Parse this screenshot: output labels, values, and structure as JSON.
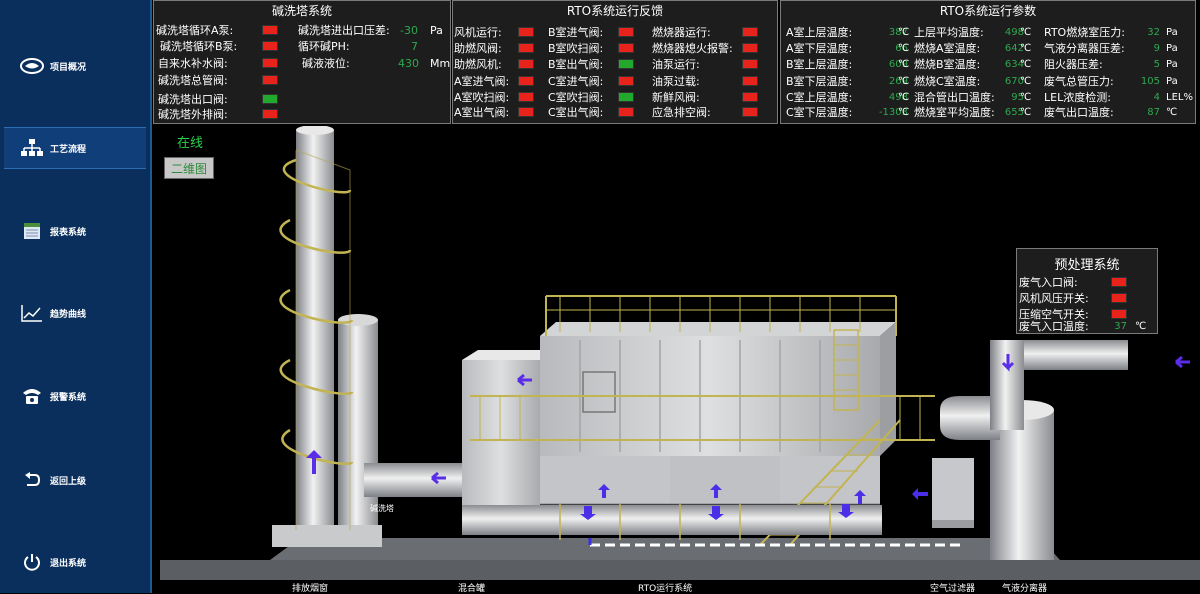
{
  "sidebar": {
    "items": [
      {
        "label": "项目概况",
        "icon": "logo-icon"
      },
      {
        "label": "工艺流程",
        "icon": "flowchart-icon"
      },
      {
        "label": "报表系统",
        "icon": "report-icon"
      },
      {
        "label": "趋势曲线",
        "icon": "trend-icon"
      },
      {
        "label": "报警系统",
        "icon": "alarm-phone-icon"
      },
      {
        "label": "返回上级",
        "icon": "back-icon"
      },
      {
        "label": "退出系统",
        "icon": "power-icon"
      }
    ],
    "active": "工艺流程"
  },
  "scrubber": {
    "title": "碱洗塔系统",
    "lamps": [
      {
        "label": "碱洗塔循环A泵:",
        "status": "red"
      },
      {
        "label": "碱洗塔循环B泵:",
        "status": "red"
      },
      {
        "label": "自来水补水阀:",
        "status": "red"
      },
      {
        "label": "碱洗塔总管阀:",
        "status": "red"
      },
      {
        "label": "碱洗塔出口阀:",
        "status": "green"
      },
      {
        "label": "碱洗塔外排阀:",
        "status": "red"
      }
    ],
    "values": [
      {
        "label": "碱洗塔进出口压差:",
        "value": "-30",
        "unit": "Pa"
      },
      {
        "label": "循环碱PH:",
        "value": "7",
        "unit": ""
      },
      {
        "label": "碱液液位:",
        "value": "430",
        "unit": "Mm"
      }
    ]
  },
  "feedback": {
    "title": "RTO系统运行反馈",
    "col1": [
      {
        "label": "风机运行:",
        "status": "red"
      },
      {
        "label": "助燃风阀:",
        "status": "red"
      },
      {
        "label": "助燃风机:",
        "status": "red"
      },
      {
        "label": "A室进气阀:",
        "status": "red"
      },
      {
        "label": "A室吹扫阀:",
        "status": "red"
      },
      {
        "label": "A室出气阀:",
        "status": "red"
      }
    ],
    "col2": [
      {
        "label": "B室进气阀:",
        "status": "red"
      },
      {
        "label": "B室吹扫阀:",
        "status": "red"
      },
      {
        "label": "B室出气阀:",
        "status": "green"
      },
      {
        "label": "C室进气阀:",
        "status": "red"
      },
      {
        "label": "C室吹扫阀:",
        "status": "green"
      },
      {
        "label": "C室出气阀:",
        "status": "red"
      }
    ],
    "col3": [
      {
        "label": "燃烧器运行:",
        "status": "red"
      },
      {
        "label": "燃烧器熄火报警:",
        "status": "red"
      },
      {
        "label": "油泵运行:",
        "status": "red"
      },
      {
        "label": "油泵过载:",
        "status": "red"
      },
      {
        "label": "新鲜风阀:",
        "status": "red"
      },
      {
        "label": "应急排空阀:",
        "status": "red"
      }
    ]
  },
  "params": {
    "title": "RTO系统运行参数",
    "col1": [
      {
        "label": "A室上层温度:",
        "value": "387",
        "unit": "℃"
      },
      {
        "label": "A室下层温度:",
        "value": "66",
        "unit": "℃"
      },
      {
        "label": "B室上层温度:",
        "value": "609",
        "unit": "℃"
      },
      {
        "label": "B室下层温度:",
        "value": "269",
        "unit": "℃"
      },
      {
        "label": "C室上层温度:",
        "value": "498",
        "unit": "℃"
      },
      {
        "label": "C室下层温度:",
        "value": "-1303",
        "unit": "℃"
      }
    ],
    "col2": [
      {
        "label": "上层平均温度:",
        "value": "498",
        "unit": "℃"
      },
      {
        "label": "燃烧A室温度:",
        "value": "642",
        "unit": "℃"
      },
      {
        "label": "燃烧B室温度:",
        "value": "634",
        "unit": "℃"
      },
      {
        "label": "燃烧C室温度:",
        "value": "670",
        "unit": "℃"
      },
      {
        "label": "混合管出口温度:",
        "value": "95",
        "unit": "℃"
      },
      {
        "label": "燃烧室平均温度:",
        "value": "655",
        "unit": "℃"
      }
    ],
    "col3": [
      {
        "label": "RTO燃烧室压力:",
        "value": "32",
        "unit": "Pa"
      },
      {
        "label": "气液分离器压差:",
        "value": "9",
        "unit": "Pa"
      },
      {
        "label": "阻火器压差:",
        "value": "5",
        "unit": "Pa"
      },
      {
        "label": "废气总管压力:",
        "value": "105",
        "unit": "Pa"
      },
      {
        "label": "LEL浓度检测:",
        "value": "4",
        "unit": "LEL%"
      },
      {
        "label": "废气出口温度:",
        "value": "87",
        "unit": "℃"
      }
    ]
  },
  "pretreat": {
    "title": "预处理系统",
    "lamps": [
      {
        "label": "废气入口阀:",
        "status": "red"
      },
      {
        "label": "风机风压开关:",
        "status": "red"
      },
      {
        "label": "压缩空气开关:",
        "status": "red"
      }
    ],
    "temp": {
      "label": "废气入口温度:",
      "value": "37",
      "unit": "℃"
    }
  },
  "status_text": "在线",
  "view_button": "二维图",
  "scene_labels": {
    "scrubber_tag": "碱洗塔",
    "chimney": "排放烟窗",
    "mixer": "混合罐",
    "rto": "RTO运行系统",
    "air_filter": "空气过滤器",
    "separator": "气液分离器"
  },
  "colors": {
    "lamp_red": "#e8231c",
    "lamp_green": "#22a82c",
    "value_green": "#2fa84f",
    "sidebar": "#0a2f5c"
  }
}
